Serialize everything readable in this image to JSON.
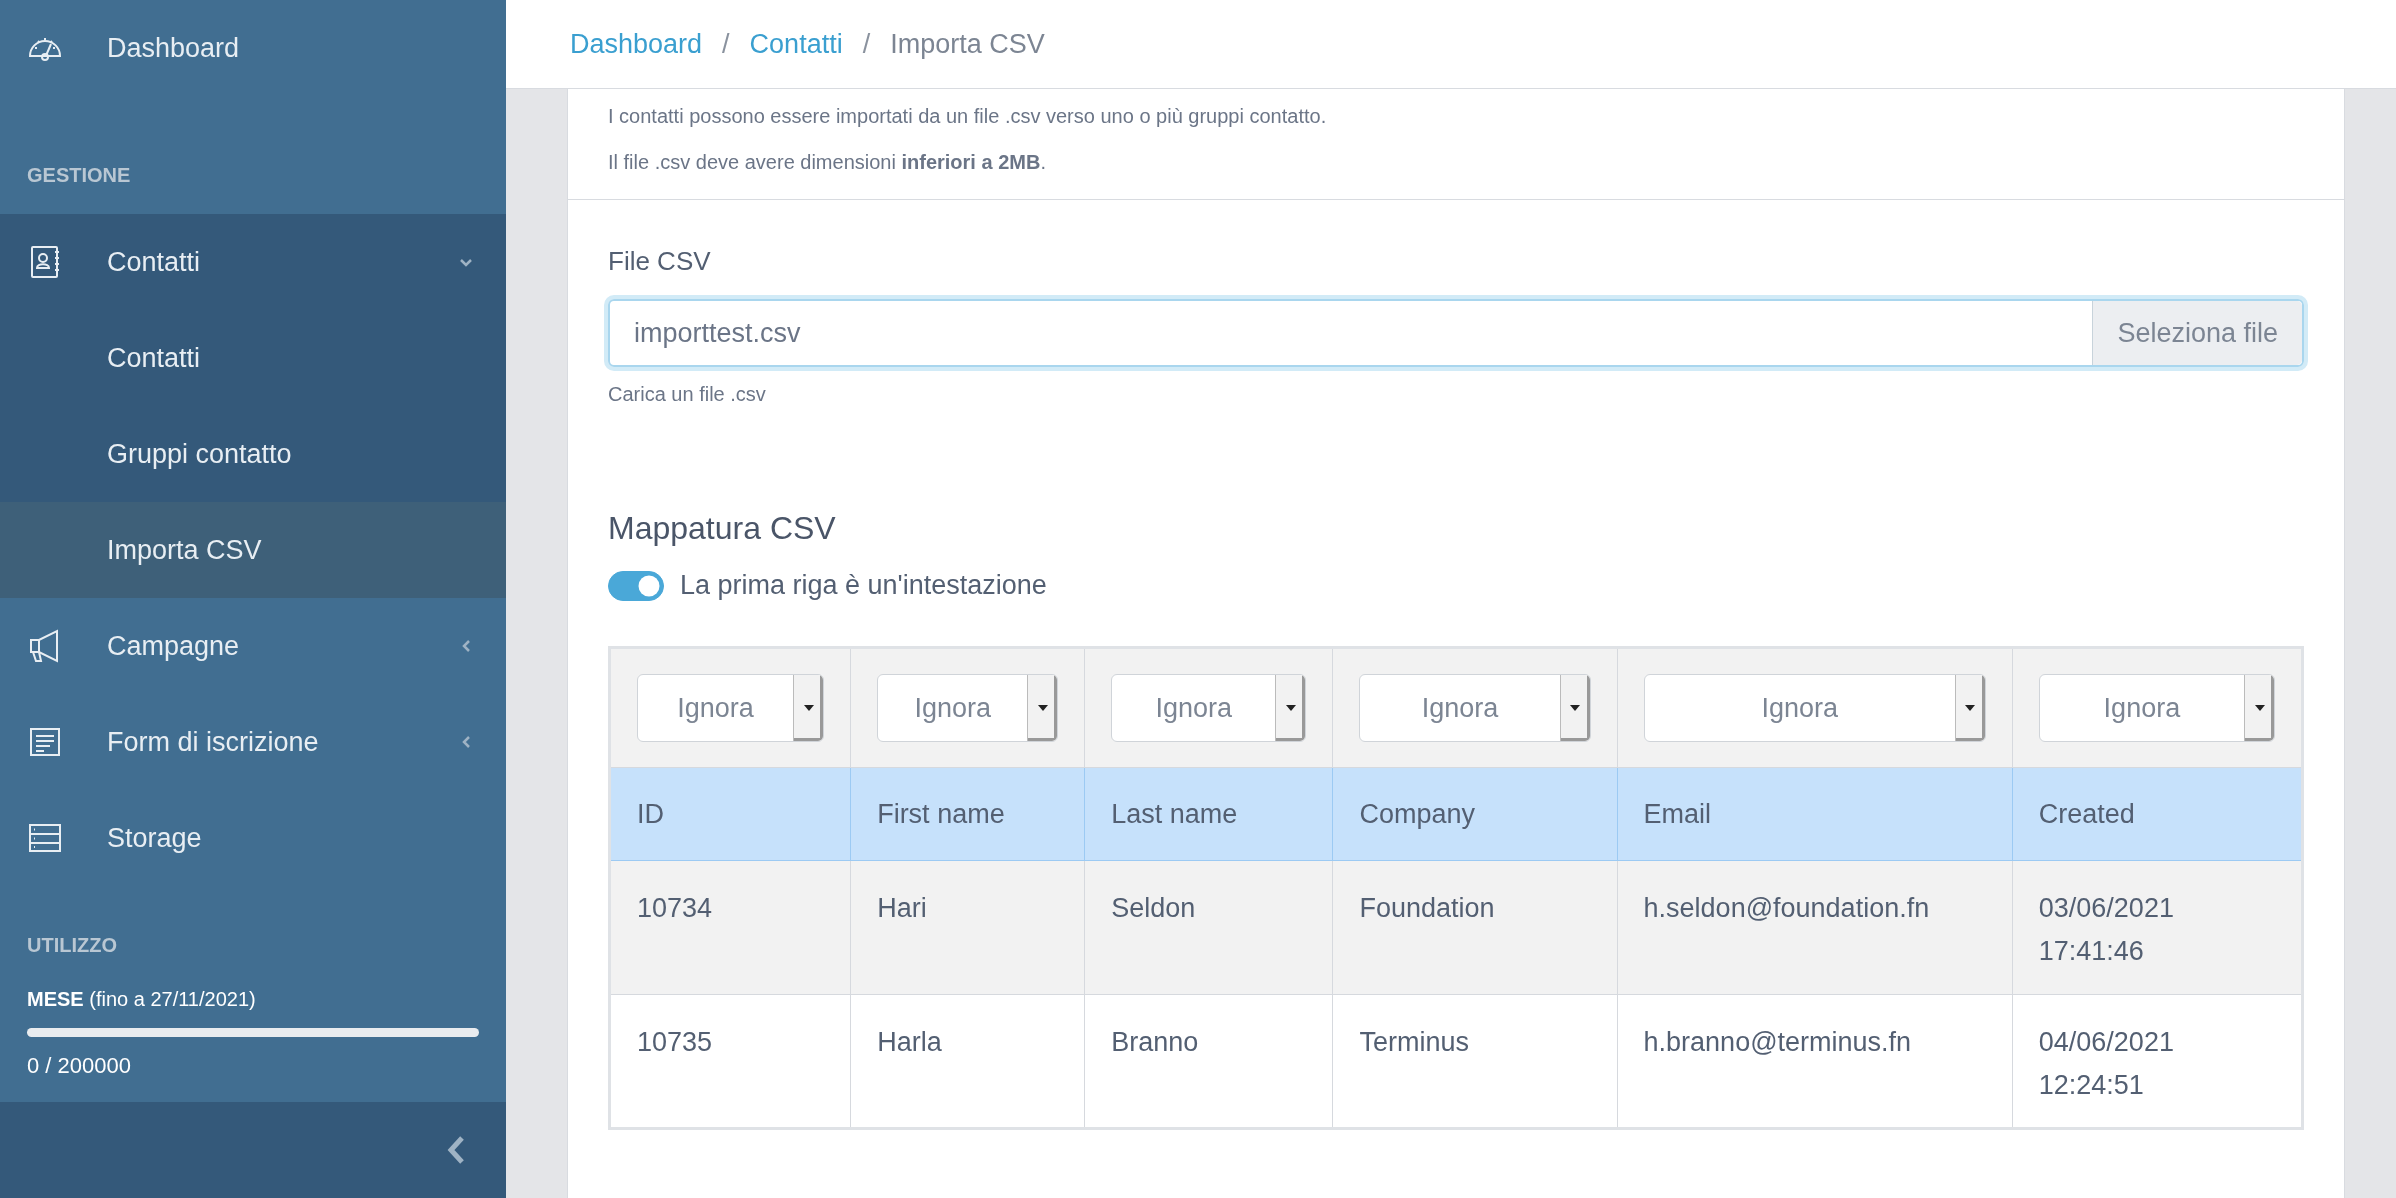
{
  "sidebar": {
    "items": [
      {
        "kind": "link",
        "label": "Dashboard"
      },
      {
        "kind": "heading",
        "label": "GESTIONE"
      },
      {
        "kind": "group",
        "label": "Contatti",
        "expanded": true,
        "children": [
          {
            "label": "Contatti",
            "selected": false
          },
          {
            "label": "Gruppi contatto",
            "selected": false
          },
          {
            "label": "Importa CSV",
            "selected": true
          }
        ]
      },
      {
        "kind": "group",
        "label": "Campagne",
        "expanded": false
      },
      {
        "kind": "group",
        "label": "Form di iscrizione",
        "expanded": false
      },
      {
        "kind": "link",
        "label": "Storage"
      }
    ],
    "usage": {
      "heading": "UTILIZZO",
      "label": "**MESE** (fino a 27/11/2021)",
      "level": 0,
      "reading": "0 / 200000"
    }
  },
  "breadcrumb": [
    {
      "label": "Dashboard",
      "current": false
    },
    {
      "separator": "/",
      "label": "Contatti",
      "current": false
    },
    {
      "separator": "/",
      "label": "Importa CSV",
      "current": true
    }
  ],
  "intro": [
    "I contatti possono essere importati da un file .csv verso uno o più gruppi contatto.",
    "Il file .csv deve avere dimensioni **inferiori a 2MB**."
  ],
  "file_field": {
    "label": "File CSV",
    "value": "importtest.csv",
    "button": "Seleziona file",
    "help": "Carica un file .csv"
  },
  "mapping": {
    "title": "Mappatura CSV",
    "header_switch": {
      "label": "La prima riga è un'intestazione",
      "on": true
    },
    "selects": [
      "Ignora",
      "Ignora",
      "Ignora",
      "Ignora",
      "Ignora",
      "Ignora"
    ],
    "columns": [
      "ID",
      "First name",
      "Last name",
      "Company",
      "Email",
      "Created"
    ],
    "rows": [
      [
        "10734",
        "Hari",
        "Seldon",
        "Foundation",
        "h.seldon@foundation.fn",
        "03/06/2021\n17:41:46"
      ],
      [
        "10735",
        "Harla",
        "Branno",
        "Terminus",
        "h.branno@terminus.fn",
        "04/06/2021\n12:24:51"
      ]
    ]
  }
}
